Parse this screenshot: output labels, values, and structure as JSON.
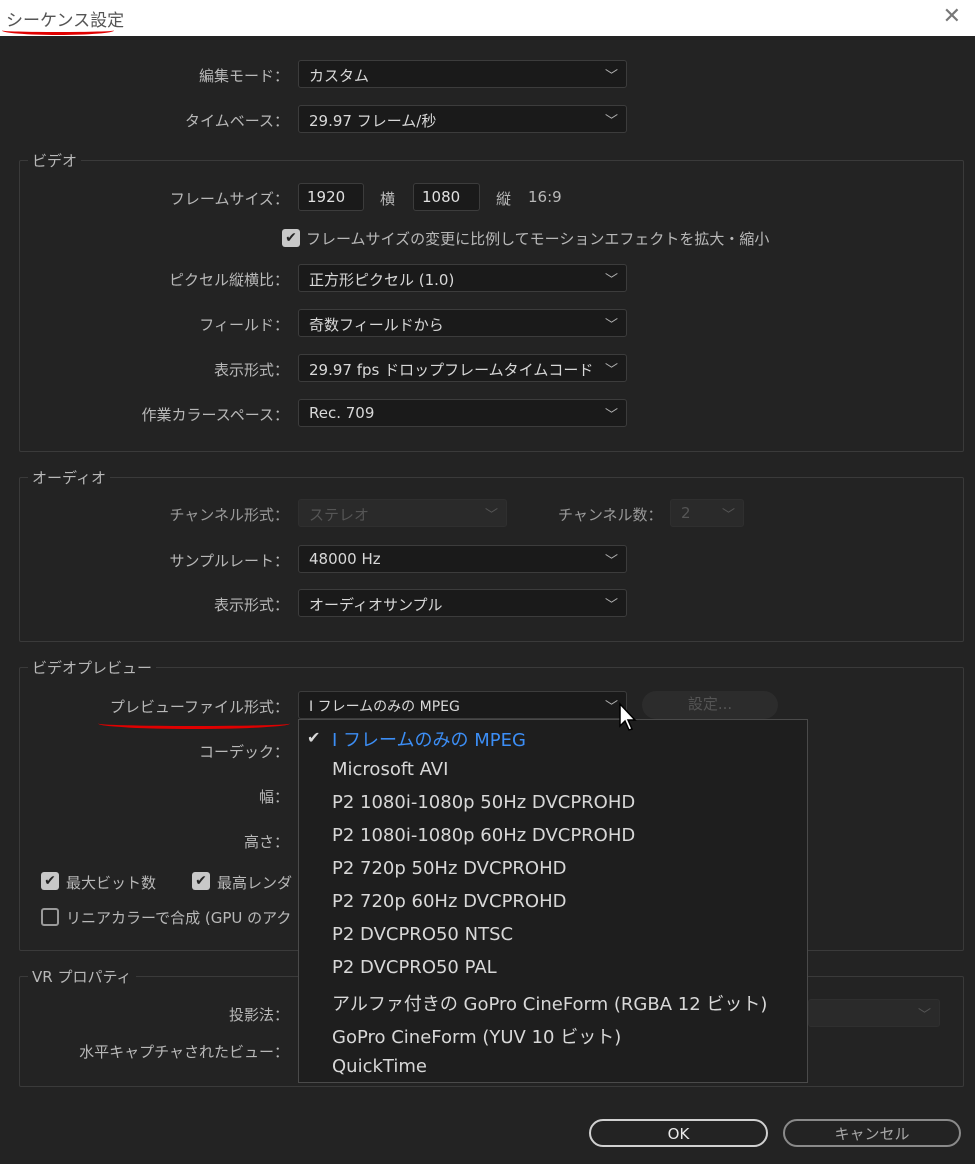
{
  "title": "シーケンス設定",
  "edit_mode": {
    "label": "編集モード：",
    "value": "カスタム"
  },
  "timebase": {
    "label": "タイムベース：",
    "value": "29.97  フレーム/秒"
  },
  "video": {
    "group_title": "ビデオ",
    "frame_size_label": "フレームサイズ：",
    "width": "1920",
    "horizontal_label": "横",
    "height": "1080",
    "vertical_label": "縦",
    "aspect": "16:9",
    "scale_checkbox_label": "フレームサイズの変更に比例してモーションエフェクトを拡大・縮小",
    "pixel_aspect_label": "ピクセル縦横比：",
    "pixel_aspect_value": "正方形ピクセル (1.0)",
    "field_label": "フィールド：",
    "field_value": "奇数フィールドから",
    "display_format_label": "表示形式：",
    "display_format_value": "29.97  fps ドロップフレームタイムコード",
    "color_space_label": "作業カラースペース：",
    "color_space_value": "Rec. 709"
  },
  "audio": {
    "group_title": "オーディオ",
    "channel_format_label": "チャンネル形式：",
    "channel_format_value": "ステレオ",
    "channel_count_label": "チャンネル数：",
    "channel_count_value": "2",
    "sample_rate_label": "サンプルレート：",
    "sample_rate_value": "48000 Hz",
    "display_format_label": "表示形式：",
    "display_format_value": "オーディオサンプル"
  },
  "video_preview": {
    "group_title": "ビデオプレビュー",
    "preview_format_label": "プレビューファイル形式：",
    "preview_format_value": "I フレームのみの  MPEG",
    "settings_button": "設定...",
    "codec_label": "コーデック：",
    "width_label": "幅：",
    "height_label": "高さ：",
    "max_bit_depth_label": "最大ビット数",
    "max_render_label": "最高レンダ",
    "linear_color_label": "リニアカラーで合成 (GPU のアク"
  },
  "vr": {
    "group_title": "VR プロパティ",
    "projection_label": "投影法：",
    "horizontal_view_label": "水平キャプチャされたビュー："
  },
  "menu_items": [
    {
      "label": "I フレームのみの  MPEG",
      "selected": true
    },
    {
      "label": "Microsoft AVI",
      "selected": false
    },
    {
      "label": "P2 1080i-1080p 50Hz DVCPROHD",
      "selected": false
    },
    {
      "label": "P2 1080i-1080p 60Hz DVCPROHD",
      "selected": false
    },
    {
      "label": "P2 720p 50Hz DVCPROHD",
      "selected": false
    },
    {
      "label": "P2 720p 60Hz DVCPROHD",
      "selected": false
    },
    {
      "label": "P2 DVCPRO50 NTSC",
      "selected": false
    },
    {
      "label": "P2 DVCPRO50 PAL",
      "selected": false
    },
    {
      "label": "アルファ付きの GoPro  CineForm  (RGBA  12  ビット)",
      "selected": false
    },
    {
      "label": "GoPro  CineForm  (YUV  10  ビット)",
      "selected": false
    },
    {
      "label": "QuickTime",
      "selected": false
    }
  ],
  "buttons": {
    "ok": "OK",
    "cancel": "キャンセル"
  },
  "colors": {
    "annotation": "#e00000",
    "selected": "#3c8ef5",
    "background": "#232323"
  }
}
